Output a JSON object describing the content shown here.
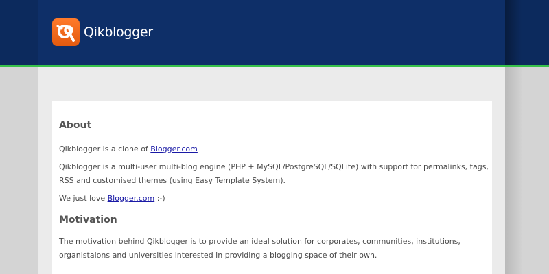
{
  "header": {
    "logo_text": "Qikblogger",
    "logo_icon": "qikblogger-logo-icon",
    "brand_color": "#0e2f68",
    "accent_line_color": "#37c24a",
    "logo_color": "#f26522"
  },
  "content": {
    "about": {
      "heading": "About",
      "p1_text": "Qikblogger is a clone of ",
      "p1_link": "Blogger.com",
      "p2_text": "Qikblogger is a multi-user multi-blog engine (PHP + MySQL/PostgreSQL/SQLite) with support for permalinks, tags, RSS and customised themes (using Easy Template System).",
      "p3_text": "We just love ",
      "p3_link": "Blogger.com",
      "p3_suffix": " :-)"
    },
    "motivation": {
      "heading": "Motivation",
      "p1_text": "The motivation behind Qikblogger is to provide an ideal solution for corporates, communities, institutions, organistaions and universities interested in providing a blogging space of their own."
    }
  }
}
